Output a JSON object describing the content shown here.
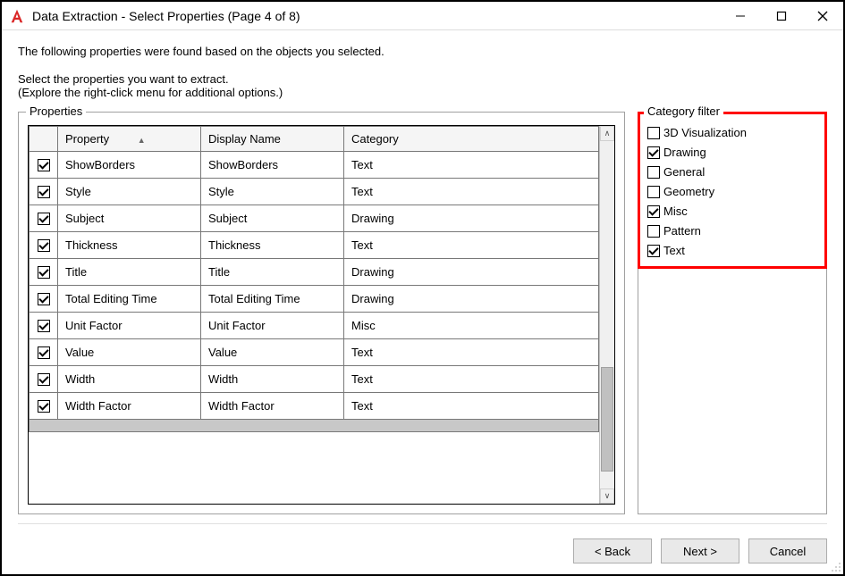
{
  "window": {
    "title": "Data Extraction - Select Properties (Page 4 of 8)"
  },
  "intro": {
    "line1": "The following properties were found based on the objects you selected.",
    "line2": "Select the properties you want to extract.",
    "line3": "(Explore the right-click menu for additional options.)"
  },
  "properties_group": {
    "label": "Properties",
    "headers": {
      "property": "Property",
      "display_name": "Display Name",
      "category": "Category"
    },
    "rows": [
      {
        "checked": true,
        "property": "ShowBorders",
        "display_name": "ShowBorders",
        "category": "Text"
      },
      {
        "checked": true,
        "property": "Style",
        "display_name": "Style",
        "category": "Text"
      },
      {
        "checked": true,
        "property": "Subject",
        "display_name": "Subject",
        "category": "Drawing"
      },
      {
        "checked": true,
        "property": "Thickness",
        "display_name": "Thickness",
        "category": "Text"
      },
      {
        "checked": true,
        "property": "Title",
        "display_name": "Title",
        "category": "Drawing"
      },
      {
        "checked": true,
        "property": "Total Editing Time",
        "display_name": "Total Editing Time",
        "category": "Drawing"
      },
      {
        "checked": true,
        "property": "Unit Factor",
        "display_name": "Unit Factor",
        "category": "Misc"
      },
      {
        "checked": true,
        "property": "Value",
        "display_name": "Value",
        "category": "Text"
      },
      {
        "checked": true,
        "property": "Width",
        "display_name": "Width",
        "category": "Text"
      },
      {
        "checked": true,
        "property": "Width Factor",
        "display_name": "Width Factor",
        "category": "Text"
      }
    ]
  },
  "category_filter": {
    "label": "Category filter",
    "items": [
      {
        "label": "3D Visualization",
        "checked": false
      },
      {
        "label": "Drawing",
        "checked": true
      },
      {
        "label": "General",
        "checked": false
      },
      {
        "label": "Geometry",
        "checked": false
      },
      {
        "label": "Misc",
        "checked": true
      },
      {
        "label": "Pattern",
        "checked": false
      },
      {
        "label": "Text",
        "checked": true
      }
    ]
  },
  "buttons": {
    "back": "< Back",
    "next": "Next >",
    "cancel": "Cancel"
  }
}
